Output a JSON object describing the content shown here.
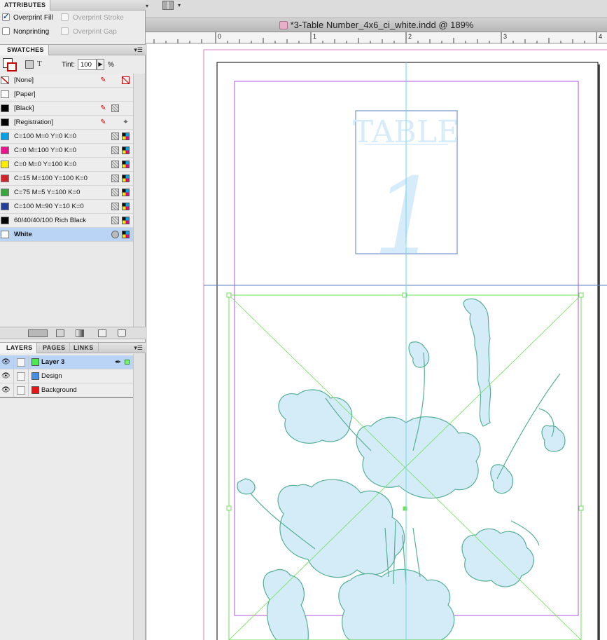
{
  "attributes": {
    "tab": "ATTRIBUTES",
    "overprint_fill": "Overprint Fill",
    "overprint_stroke": "Overprint Stroke",
    "nonprinting": "Nonprinting",
    "overprint_gap": "Overprint Gap"
  },
  "swatches": {
    "tab": "SWATCHES",
    "tint_label": "Tint:",
    "tint_value": "100",
    "percent": "%",
    "items": [
      {
        "name": "[None]",
        "color": "none"
      },
      {
        "name": "[Paper]",
        "color": "#ffffff"
      },
      {
        "name": "[Black]",
        "color": "#000000"
      },
      {
        "name": "[Registration]",
        "color": "#000000"
      },
      {
        "name": "C=100 M=0 Y=0 K=0",
        "color": "#00a2e6"
      },
      {
        "name": "C=0 M=100 Y=0 K=0",
        "color": "#ea128d"
      },
      {
        "name": "C=0 M=0 Y=100 K=0",
        "color": "#fbec00"
      },
      {
        "name": "C=15 M=100 Y=100 K=0",
        "color": "#d1232a"
      },
      {
        "name": "C=75 M=5 Y=100 K=0",
        "color": "#3ba53f"
      },
      {
        "name": "C=100 M=90 Y=10 K=0",
        "color": "#22409a"
      },
      {
        "name": "60/40/40/100 Rich Black",
        "color": "#000000"
      },
      {
        "name": "White",
        "color": "#ffffff"
      }
    ]
  },
  "layers_panel": {
    "tabs": [
      "LAYERS",
      "PAGES",
      "LINKS"
    ],
    "layers": [
      {
        "name": "Layer 3",
        "color": "#4fe84f"
      },
      {
        "name": "Design",
        "color": "#4a90e2"
      },
      {
        "name": "Background",
        "color": "#e41818"
      }
    ]
  },
  "document": {
    "title": "*3-Table Number_4x6_ci_white.indd @ 189%",
    "ruler_numbers": [
      "0",
      "1",
      "2",
      "3",
      "4"
    ],
    "design_text": "TABLE",
    "design_number": "1"
  }
}
